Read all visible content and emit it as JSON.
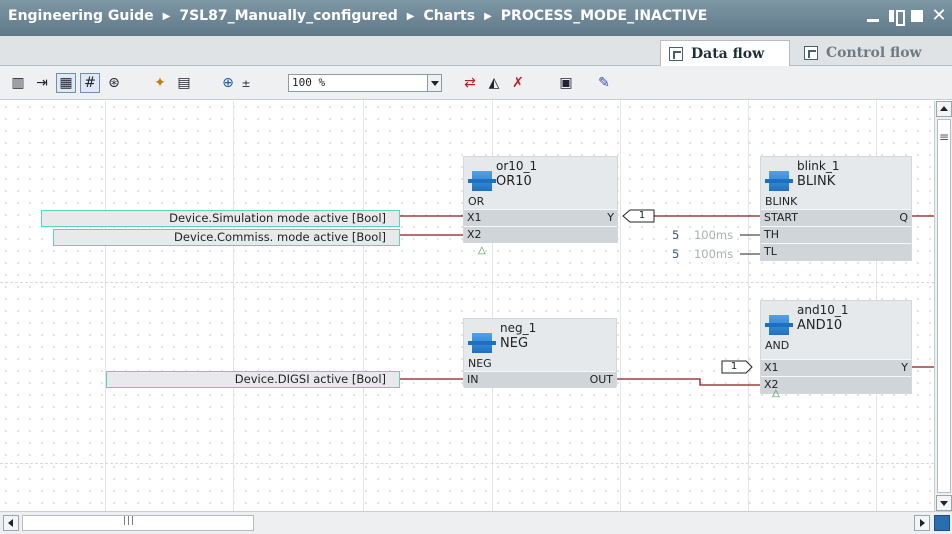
{
  "breadcrumb": [
    "Engineering Guide",
    "7SL87_Manually_configured",
    "Charts",
    "PROCESS_MODE_INACTIVE"
  ],
  "breadcrumb_separator": "▶",
  "tabs": {
    "data_flow": "Data flow",
    "control_flow": "Control flow"
  },
  "toolbar": {
    "zoom_value": "100 %"
  },
  "blocks": {
    "or10": {
      "instance": "or10_1",
      "type": "OR10",
      "kind": "OR",
      "in1": "X1",
      "in2": "X2",
      "out": "Y"
    },
    "blink": {
      "instance": "blink_1",
      "type": "BLINK",
      "kind": "BLINK",
      "in1": "START",
      "in2": "TH",
      "in3": "TL",
      "out": "Q"
    },
    "neg": {
      "instance": "neg_1",
      "type": "NEG",
      "kind": "NEG",
      "in1": "IN",
      "out": "OUT"
    },
    "and10": {
      "instance": "and10_1",
      "type": "AND10",
      "kind": "AND",
      "in1": "X1",
      "in2": "X2",
      "out": "Y"
    }
  },
  "signals": {
    "sim_mode": "Device.Simulation mode active [Bool]",
    "commiss_mode": "Device.Commiss. mode active [Bool]",
    "digsi_active": "Device.DIGSI active [Bool]"
  },
  "params": {
    "th_value": "5",
    "th_unit": "100ms",
    "tl_value": "5",
    "tl_unit": "100ms"
  },
  "connector_tags": {
    "or_out": "1",
    "and_x1": "1"
  },
  "colors": {
    "wire": "#8b1a1a",
    "pin_border": "#5fd1c1",
    "title_bar": "#6f8898",
    "block_fill": "#e6e9ec"
  }
}
